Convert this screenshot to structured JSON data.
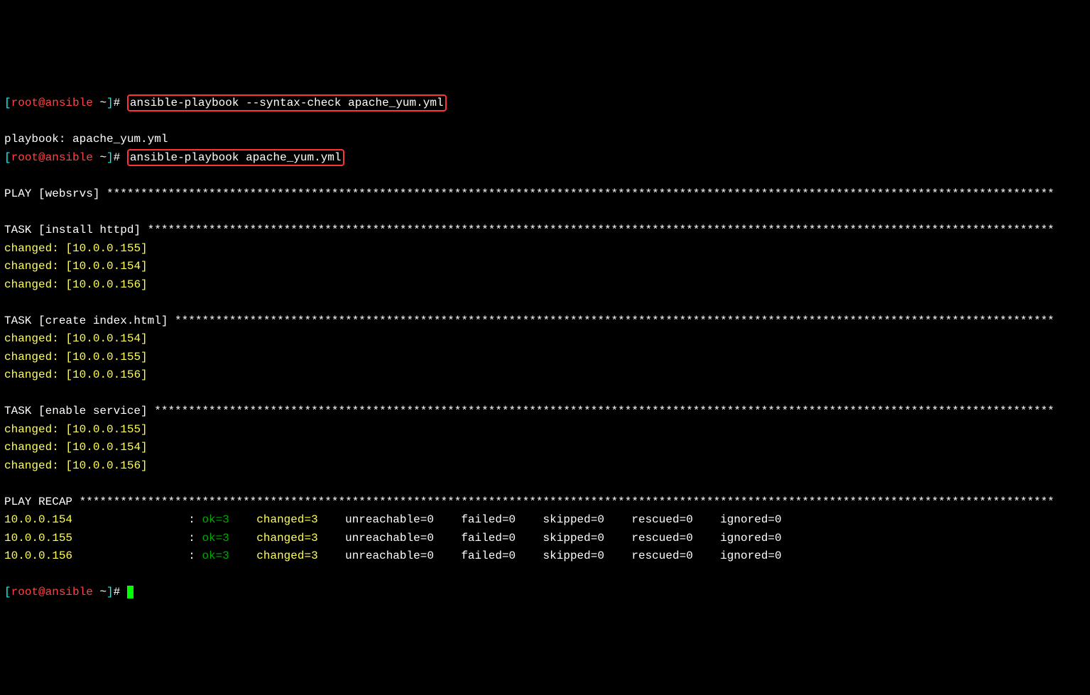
{
  "prompt": {
    "bracket_open": "[",
    "user": "root",
    "at": "@",
    "host": "ansible",
    "path": " ~",
    "bracket_close": "]",
    "hash": "# "
  },
  "cmd1": "ansible-playbook --syntax-check apache_yum.yml",
  "playbook_line": "playbook: apache_yum.yml",
  "cmd2": "ansible-playbook apache_yum.yml",
  "play_header": {
    "label": "PLAY [websrvs] ",
    "stars": "*******************************************************************************************************************************************"
  },
  "task1_header": {
    "label": "TASK [install httpd] ",
    "stars": "*************************************************************************************************************************************"
  },
  "task1_results": [
    {
      "status": "changed",
      "host": "10.0.0.155"
    },
    {
      "status": "changed",
      "host": "10.0.0.154"
    },
    {
      "status": "changed",
      "host": "10.0.0.156"
    }
  ],
  "task2_header": {
    "label": "TASK [create index.html] ",
    "stars": "*********************************************************************************************************************************"
  },
  "task2_results": [
    {
      "status": "changed",
      "host": "10.0.0.154"
    },
    {
      "status": "changed",
      "host": "10.0.0.155"
    },
    {
      "status": "changed",
      "host": "10.0.0.156"
    }
  ],
  "task3_header": {
    "label": "TASK [enable service] ",
    "stars": "************************************************************************************************************************************"
  },
  "task3_results": [
    {
      "status": "changed",
      "host": "10.0.0.155"
    },
    {
      "status": "changed",
      "host": "10.0.0.154"
    },
    {
      "status": "changed",
      "host": "10.0.0.156"
    }
  ],
  "recap_header": {
    "label": "PLAY RECAP ",
    "stars": "***********************************************************************************************************************************************"
  },
  "recap": [
    {
      "host": "10.0.0.154",
      "ok": "ok=3",
      "changed": "changed=3",
      "unreachable": "unreachable=0",
      "failed": "failed=0",
      "skipped": "skipped=0",
      "rescued": "rescued=0",
      "ignored": "ignored=0"
    },
    {
      "host": "10.0.0.155",
      "ok": "ok=3",
      "changed": "changed=3",
      "unreachable": "unreachable=0",
      "failed": "failed=0",
      "skipped": "skipped=0",
      "rescued": "rescued=0",
      "ignored": "ignored=0"
    },
    {
      "host": "10.0.0.156",
      "ok": "ok=3",
      "changed": "changed=3",
      "unreachable": "unreachable=0",
      "failed": "failed=0",
      "skipped": "skipped=0",
      "rescued": "rescued=0",
      "ignored": "ignored=0"
    }
  ]
}
